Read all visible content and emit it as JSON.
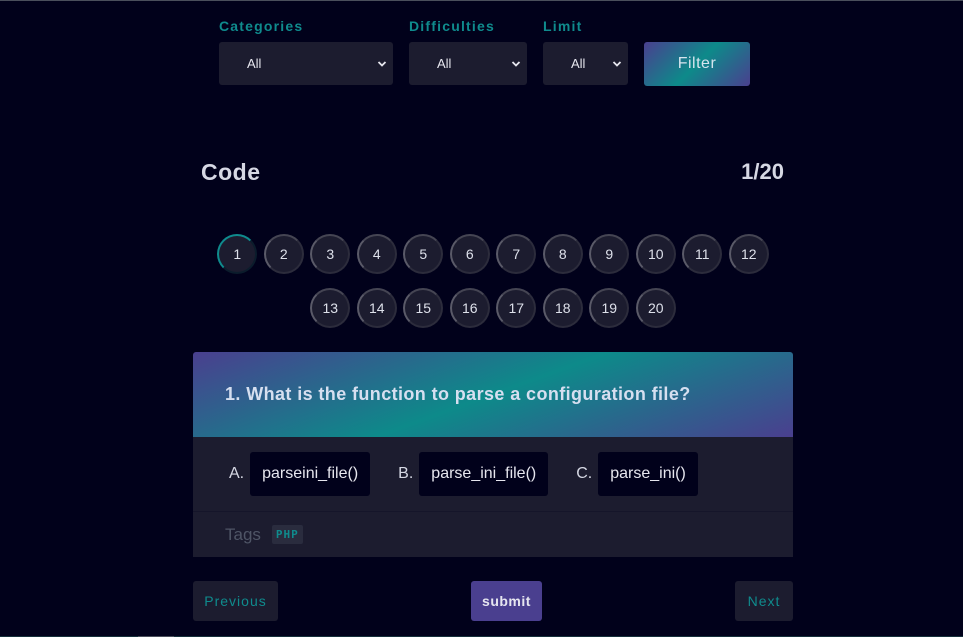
{
  "filters": {
    "categories": {
      "label": "Categories",
      "value": "All"
    },
    "difficulties": {
      "label": "Difficulties",
      "value": "All"
    },
    "limit": {
      "label": "Limit",
      "value": "All"
    },
    "filter_button": "Filter"
  },
  "quiz": {
    "category": "Code",
    "progress": "1/20",
    "current": 1,
    "pages": [
      "1",
      "2",
      "3",
      "4",
      "5",
      "6",
      "7",
      "8",
      "9",
      "10",
      "11",
      "12",
      "13",
      "14",
      "15",
      "16",
      "17",
      "18",
      "19",
      "20"
    ]
  },
  "question": {
    "text": "1. What is the function to parse a configuration file?",
    "options": [
      {
        "letter": "A.",
        "label": "parseini_file()"
      },
      {
        "letter": "B.",
        "label": "parse_ini_file()"
      },
      {
        "letter": "C.",
        "label": "parse_ini()"
      }
    ],
    "tags_label": "Tags",
    "tags": [
      "PHP"
    ]
  },
  "navigation": {
    "previous": "Previous",
    "submit": "submit",
    "next": "Next"
  },
  "colors": {
    "background": "#01011b",
    "panel": "#1c1c2f",
    "accent_teal": "#0f8b8d",
    "accent_purple": "#4a3f8f"
  }
}
